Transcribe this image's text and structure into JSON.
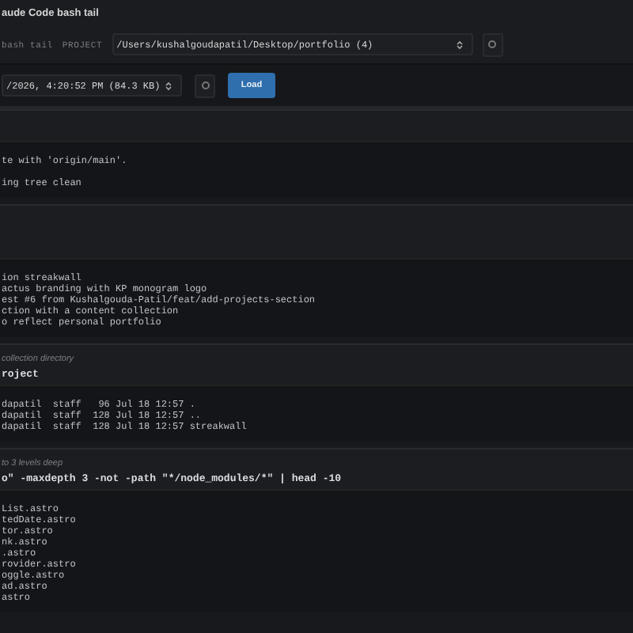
{
  "window": {
    "title": "aude Code bash tail"
  },
  "toolbar": {
    "label": "bash tail",
    "project_label": "PROJECT",
    "project_path": "/Users/kushalgoudapatil/Desktop/portfolio (4)",
    "file": "/2026, 4:20:52 PM (84.3 KB)",
    "load_button": "Load"
  },
  "blocks": [
    {
      "output": [
        "te with 'origin/main'.",
        "ing tree clean"
      ],
      "blank_between_lines": true
    },
    {
      "output": [
        "ion streakwall",
        "actus branding with KP monogram logo",
        "est #6 from Kushalgouda-Patil/feat/add-projects-section",
        "ction with a content collection",
        "o reflect personal portfolio"
      ]
    },
    {
      "description": "collection directory",
      "command": "roject",
      "output": [
        "dapatil  staff   96 Jul 18 12:57 .",
        "dapatil  staff  128 Jul 18 12:57 ..",
        "dapatil  staff  128 Jul 18 12:57 streakwall"
      ]
    },
    {
      "description": "to 3 levels deep",
      "command": "o\" -maxdepth 3 -not -path \"*/node_modules/*\" | head -10",
      "output": [
        "List.astro",
        "tedDate.astro",
        "tor.astro",
        "nk.astro",
        ".astro",
        "rovider.astro",
        "oggle.astro",
        "ad.astro",
        "astro"
      ]
    }
  ]
}
